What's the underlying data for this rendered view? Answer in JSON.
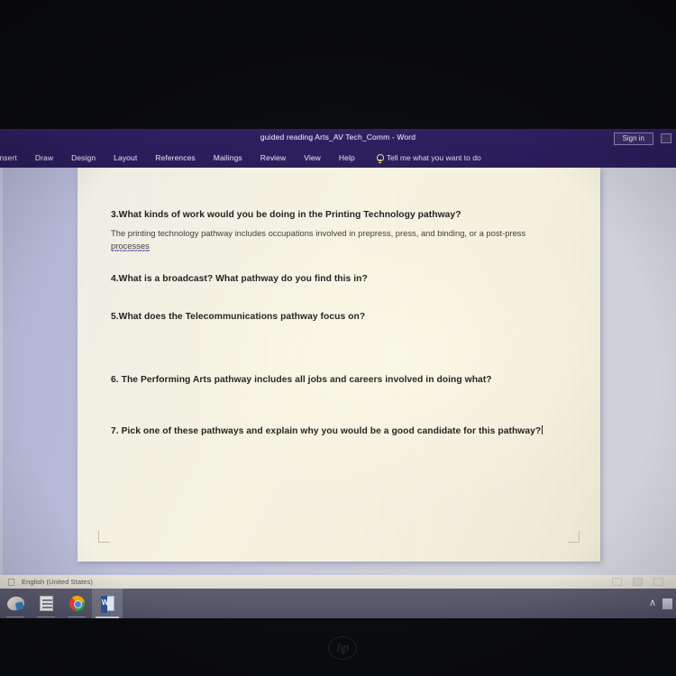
{
  "window": {
    "title": "guided reading Arts_AV Tech_Comm  -  Word",
    "sign_in_label": "Sign in",
    "window_control": "restore-window-icon"
  },
  "ribbon": {
    "tabs": [
      {
        "label": "Insert"
      },
      {
        "label": "Draw"
      },
      {
        "label": "Design"
      },
      {
        "label": "Layout"
      },
      {
        "label": "References"
      },
      {
        "label": "Mailings"
      },
      {
        "label": "Review"
      },
      {
        "label": "View"
      },
      {
        "label": "Help"
      }
    ],
    "tell_me": "Tell me what you want to do",
    "tell_me_icon": "lightbulb-icon"
  },
  "document": {
    "questions": [
      {
        "number": "3.",
        "text": "3.What kinds of work would you be doing in the Printing Technology pathway?",
        "answer_before": "The printing technology pathway includes occupations involved in prepress, press, and binding, or a post-press ",
        "answer_misspelled": "processes"
      },
      {
        "number": "4.",
        "text": "4.What is a broadcast? What pathway do you find this in?"
      },
      {
        "number": "5.",
        "text": "5.What does the Telecommunications pathway focus on?"
      },
      {
        "number": "6.",
        "text": "6. The Performing Arts pathway includes all jobs and careers involved in doing what?"
      },
      {
        "number": "7.",
        "text": "7. Pick one of these pathways and explain why you would be a good candidate for this pathway?"
      }
    ]
  },
  "status_bar": {
    "language": "English (United States)",
    "proofing_icon": "proofing-errors-icon",
    "views": [
      "read-mode-icon",
      "print-layout-icon",
      "web-layout-icon"
    ]
  },
  "taskbar": {
    "items": [
      {
        "name": "paint-3d-icon",
        "state": "open"
      },
      {
        "name": "sticky-notes-icon",
        "state": "open"
      },
      {
        "name": "google-chrome-icon",
        "state": "open"
      },
      {
        "name": "microsoft-word-icon",
        "state": "active"
      }
    ],
    "tray_chevron": "∧"
  },
  "hardware": {
    "bezel_logo": "hp"
  },
  "colors": {
    "ribbon_purple": "#2b1d5c",
    "canvas_blue_grey": "#bfc2d6",
    "page_cream": "#f4f1e1",
    "taskbar_grey": "#55576a",
    "spellcheck_underline": "#5b56b8"
  }
}
